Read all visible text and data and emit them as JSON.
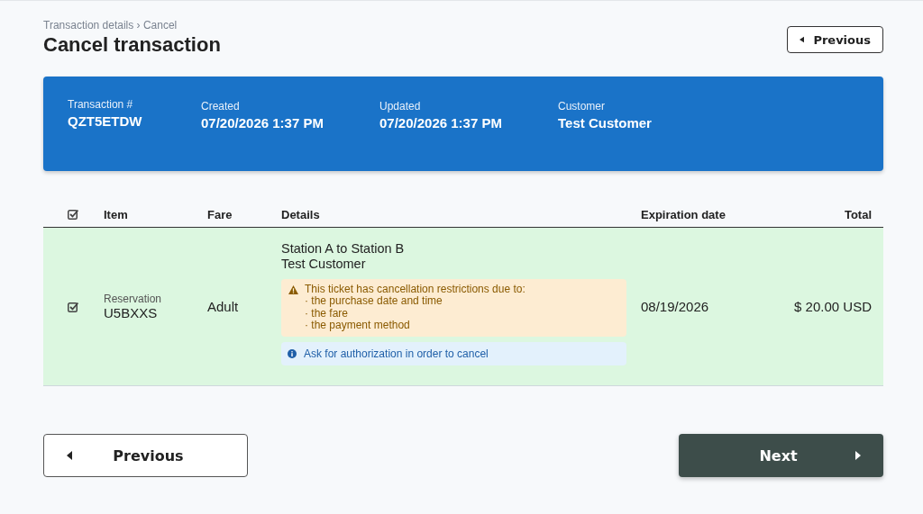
{
  "breadcrumb": "Transaction details › Cancel",
  "title": "Cancel transaction",
  "top_button": {
    "label": "Previous"
  },
  "summary": [
    {
      "label": "Transaction #",
      "value": "QZT5ETDW"
    },
    {
      "label": "Created",
      "value": "07/20/2026 1:37 PM"
    },
    {
      "label": "Updated",
      "value": "07/20/2026 1:37 PM"
    },
    {
      "label": "Customer",
      "value": "Test Customer"
    }
  ],
  "table": {
    "select_all_checked": true,
    "columns": [
      "Item",
      "Fare",
      "Details",
      "Expiration date",
      "Total"
    ],
    "rows": [
      {
        "checked": true,
        "item_type": "Reservation",
        "item_code": "U5BXXS",
        "fare": "Adult",
        "route": "Station A to Station B",
        "customer": "Test Customer",
        "warning": {
          "title": "This ticket has cancellation restrictions due to:",
          "reasons": [
            "· the purchase date and time",
            "· the fare",
            "· the payment method"
          ]
        },
        "info": "Ask for authorization in order to cancel",
        "expiration": "08/19/2026",
        "total": "$ 20.00 USD"
      }
    ]
  },
  "footer": {
    "previous": "Previous",
    "next": "Next"
  }
}
